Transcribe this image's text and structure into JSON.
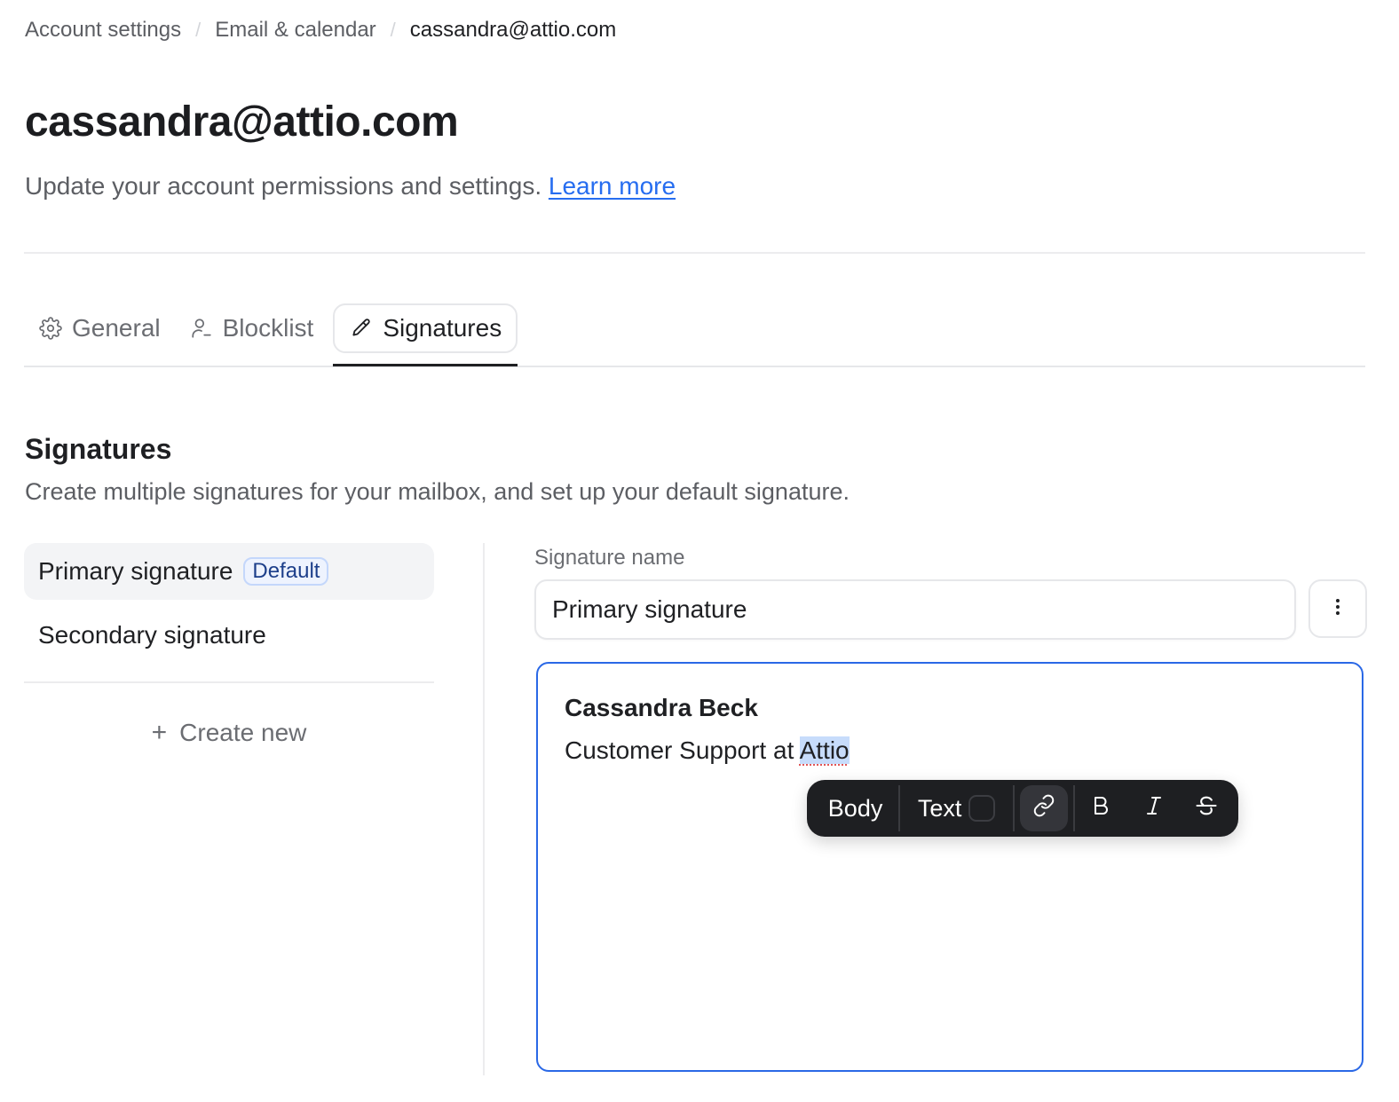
{
  "breadcrumb": {
    "items": [
      "Account settings",
      "Email & calendar",
      "cassandra@attio.com"
    ],
    "separator": "/"
  },
  "header": {
    "title": "cassandra@attio.com",
    "subtitle": "Update your account permissions and settings.",
    "learn_more": "Learn more"
  },
  "tabs": [
    {
      "label": "General",
      "icon": "gear-icon"
    },
    {
      "label": "Blocklist",
      "icon": "user-minus-icon"
    },
    {
      "label": "Signatures",
      "icon": "pencil-icon",
      "active": true
    }
  ],
  "section": {
    "title": "Signatures",
    "description": "Create multiple signatures for your mailbox, and set up your default signature."
  },
  "signature_list": {
    "items": [
      {
        "label": "Primary signature",
        "badge": "Default",
        "selected": true
      },
      {
        "label": "Secondary signature"
      }
    ],
    "create_new": "Create new",
    "create_icon": "+"
  },
  "editor_pane": {
    "field_label": "Signature name",
    "name_value": "Primary signature",
    "body": {
      "name_line": "Cassandra Beck",
      "role_prefix": "Customer Support at ",
      "selected_word": "Attio"
    }
  },
  "toolbar": {
    "body_label": "Body",
    "text_label": "Text",
    "icons": [
      "link-icon",
      "bold-icon",
      "italic-icon",
      "strikethrough-icon"
    ],
    "bold_glyph": "B",
    "italic_glyph": "I"
  },
  "colors": {
    "accent": "#266df0",
    "editor_border": "#2a68e6",
    "selection": "#c7dcfb",
    "toolbar_bg": "#1e1f22",
    "badge_bg": "#eef3fe",
    "badge_border": "#c4d7fb"
  }
}
